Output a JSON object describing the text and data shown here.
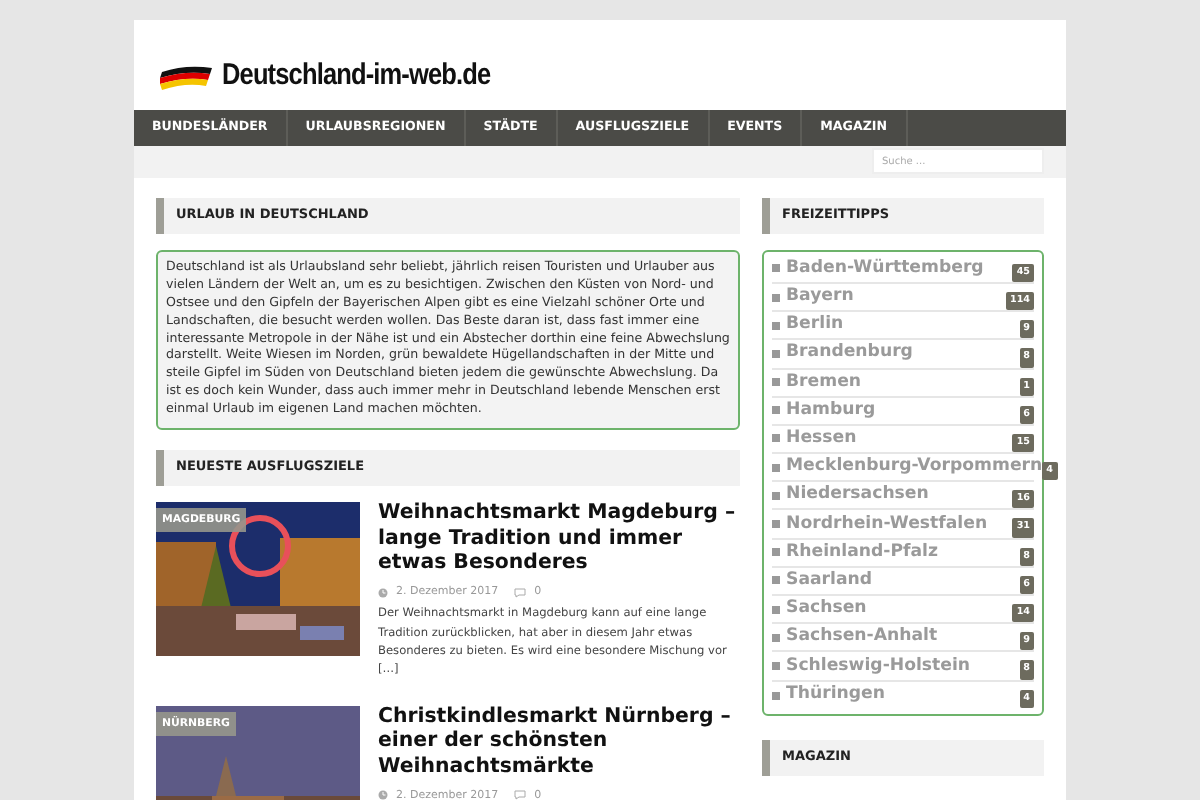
{
  "site": {
    "title": "Deutschland-im-web.de"
  },
  "nav": [
    "BUNDESLÄNDER",
    "URLAUBSREGIONEN",
    "STÄDTE",
    "AUSFLUGSZIELE",
    "EVENTS",
    "MAGAZIN"
  ],
  "search": {
    "placeholder": "Suche ..."
  },
  "intro": {
    "heading": "URLAUB IN DEUTSCHLAND",
    "text": "Deutschland ist als Urlaubsland sehr beliebt, jährlich reisen Touristen und Urlauber aus vielen Ländern der Welt an, um es zu besichtigen. Zwischen den Küsten von Nord- und Ostsee und den Gipfeln der Bayerischen Alpen gibt es eine Vielzahl schöner Orte und Landschaften, die besucht werden wollen. Das Beste daran ist, dass fast immer eine interessante Metropole in der Nähe ist und ein Abstecher dorthin eine feine Abwechslung darstellt. Weite Wiesen im Norden, grün bewaldete Hügellandschaften in der Mitte und steile Gipfel im Süden von Deutschland bieten jedem die gewünschte Abwechslung. Da ist es doch kein Wunder, dass auch immer mehr in Deutschland lebende Menschen erst einmal Urlaub im eigenen Land machen möchten."
  },
  "latest": {
    "heading": "NEUESTE AUSFLUGSZIELE",
    "posts": [
      {
        "category": "MAGDEBURG",
        "title": "Weihnachtsmarkt Magdeburg – lange Tradition und immer etwas Besonderes",
        "date": "2. Dezember 2017",
        "comments": "0",
        "excerpt": "Der Weihnachtsmarkt in Magdeburg kann auf eine lange Tradition zurückblicken, hat aber in diesem Jahr etwas Besonderes zu bieten. Es wird eine besondere Mischung vor […]"
      },
      {
        "category": "NÜRNBERG",
        "title": "Christkindlesmarkt Nürnberg – einer der schönsten Weihnachtsmärkte",
        "date": "2. Dezember 2017",
        "comments": "0"
      }
    ]
  },
  "sidebar": {
    "heading": "FREIZEITTIPPS",
    "items": [
      {
        "label": "Baden-Württemberg",
        "count": "45"
      },
      {
        "label": "Bayern",
        "count": "114"
      },
      {
        "label": "Berlin",
        "count": "9"
      },
      {
        "label": "Brandenburg",
        "count": "8"
      },
      {
        "label": "Bremen",
        "count": "1"
      },
      {
        "label": "Hamburg",
        "count": "6"
      },
      {
        "label": "Hessen",
        "count": "15"
      },
      {
        "label": "Mecklenburg-Vorpommern",
        "count": "4"
      },
      {
        "label": "Niedersachsen",
        "count": "16"
      },
      {
        "label": "Nordrhein-Westfalen",
        "count": "31"
      },
      {
        "label": "Rheinland-Pfalz",
        "count": "8"
      },
      {
        "label": "Saarland",
        "count": "6"
      },
      {
        "label": "Sachsen",
        "count": "14"
      },
      {
        "label": "Sachsen-Anhalt",
        "count": "9"
      },
      {
        "label": "Schleswig-Holstein",
        "count": "8"
      },
      {
        "label": "Thüringen",
        "count": "4"
      }
    ],
    "heading2": "MAGAZIN"
  }
}
